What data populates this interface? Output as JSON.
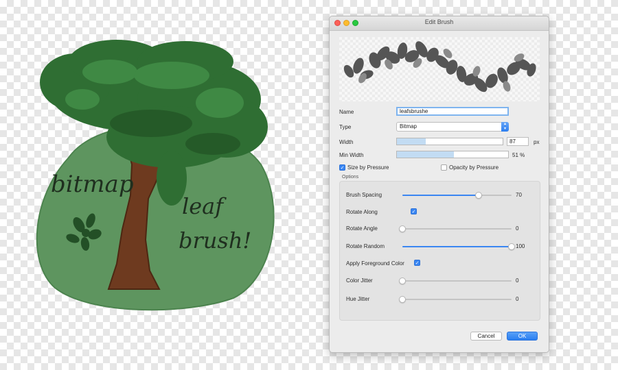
{
  "artwork": {
    "text_bitmap": "bitmap",
    "text_leaf": "leaf",
    "text_brush": "brush!"
  },
  "dialog": {
    "title": "Edit Brush",
    "name_label": "Name",
    "name_value": "leafsbrushe",
    "type_label": "Type",
    "type_value": "Bitmap",
    "width_label": "Width",
    "width_value": "87",
    "width_unit": "px",
    "width_fraction": 0.27,
    "min_width_label": "Min Width",
    "min_width_value": "51 %",
    "min_width_fraction": 0.51,
    "size_by_pressure_label": "Size by Pressure",
    "size_by_pressure_checked": true,
    "opacity_by_pressure_label": "Opacity by Pressure",
    "opacity_by_pressure_checked": false,
    "options_label": "Options",
    "options": {
      "brush_spacing_label": "Brush Spacing",
      "brush_spacing_value": "70",
      "rotate_along_label": "Rotate Along",
      "rotate_along_checked": true,
      "rotate_angle_label": "Rotate Angle",
      "rotate_angle_value": "0",
      "rotate_random_label": "Rotate Random",
      "rotate_random_value": "100",
      "apply_fg_label": "Apply Foreground Color",
      "apply_fg_checked": true,
      "color_jitter_label": "Color Jitter",
      "color_jitter_value": "0",
      "hue_jitter_label": "Hue Jitter",
      "hue_jitter_value": "0"
    },
    "cancel_label": "Cancel",
    "ok_label": "OK"
  },
  "colors": {
    "accent": "#3a86f2",
    "ground_green": "#5e955f",
    "foliage_green": "#2f6e33",
    "trunk_brown": "#6e3a1f"
  }
}
